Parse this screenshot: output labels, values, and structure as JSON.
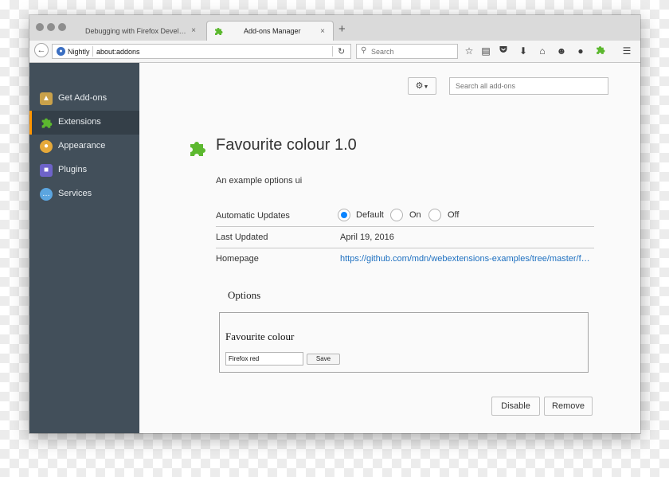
{
  "browser": {
    "tabs": [
      {
        "label": "Debugging with Firefox Develop...",
        "close": "×"
      },
      {
        "label": "Add-ons Manager",
        "close": "×"
      }
    ],
    "new_tab": "+",
    "identity": "Nightly",
    "url": "about:addons",
    "search_placeholder": "Search",
    "toolbar_icons": [
      "star-icon",
      "reading-list-icon",
      "pocket-icon",
      "download-icon",
      "home-icon",
      "emoji-icon",
      "paw-icon",
      "puzzle-icon",
      "menu-icon"
    ]
  },
  "sidebar": {
    "items": [
      {
        "label": "Get Add-ons",
        "icon": "get-addons-icon",
        "color": "#c9a14a"
      },
      {
        "label": "Extensions",
        "icon": "puzzle-icon",
        "color": "#5cb82f",
        "selected": true
      },
      {
        "label": "Appearance",
        "icon": "palette-icon",
        "color": "#e6a93a"
      },
      {
        "label": "Plugins",
        "icon": "plugin-icon",
        "color": "#6e63c9"
      },
      {
        "label": "Services",
        "icon": "chat-icon",
        "color": "#5ba5e0"
      }
    ]
  },
  "main": {
    "search_placeholder": "Search all add-ons",
    "addon": {
      "name": "Favourite colour 1.0",
      "description": "An example options ui",
      "automatic_updates_label": "Automatic Updates",
      "update_options": [
        "Default",
        "On",
        "Off"
      ],
      "update_selected": "Default",
      "last_updated_label": "Last Updated",
      "last_updated_value": "April 19, 2016",
      "homepage_label": "Homepage",
      "homepage_value": "https://github.com/mdn/webextensions-examples/tree/master/favourite-colour"
    },
    "options": {
      "legend": "Options",
      "field_label": "Favourite colour",
      "field_value": "Firefox red",
      "save_label": "Save"
    },
    "disable_label": "Disable",
    "remove_label": "Remove"
  },
  "colors": {
    "accent": "#ff9500",
    "link": "#1e70c0",
    "sidebar_bg": "#424f5a",
    "radio_checked": "#0a84ff"
  }
}
